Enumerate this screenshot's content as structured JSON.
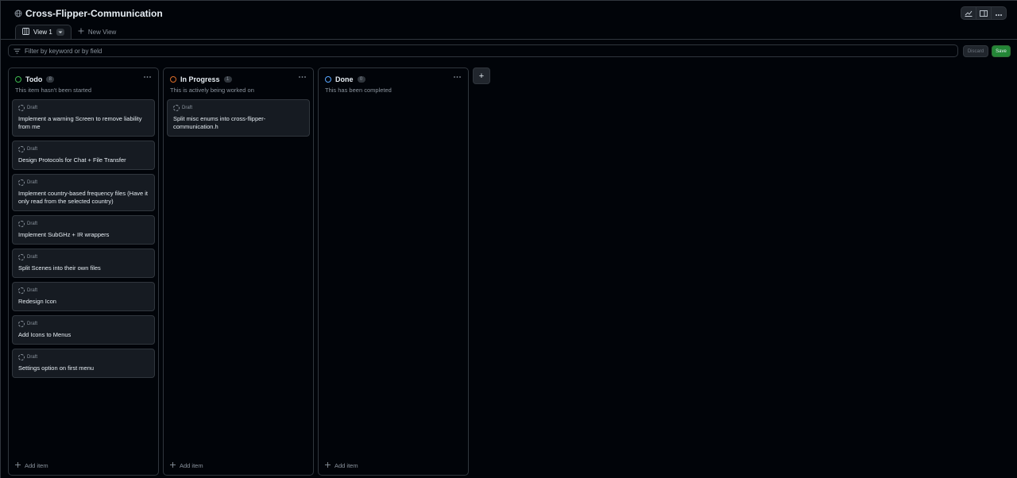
{
  "header": {
    "title": "Cross-Flipper-Communication",
    "icons": [
      "globe-icon",
      "graph-icon",
      "sidebar-icon",
      "kebab-icon"
    ]
  },
  "tabs": {
    "active_label": "View 1",
    "new_view_label": "New View"
  },
  "filter": {
    "placeholder": "Filter by keyword or by field",
    "discard_label": "Discard",
    "save_label": "Save"
  },
  "columns": [
    {
      "title": "Todo",
      "count": "8",
      "color": "#3fb950",
      "description": "This item hasn't been started",
      "add_label": "Add item",
      "cards": [
        {
          "tag": "Draft",
          "title": "Implement a warning Screen to remove liability from me"
        },
        {
          "tag": "Draft",
          "title": "Design Protocols for Chat + File Transfer"
        },
        {
          "tag": "Draft",
          "title": "Implement country-based frequency files (Have it only read from the selected country)"
        },
        {
          "tag": "Draft",
          "title": "Implement SubGHz + IR wrappers"
        },
        {
          "tag": "Draft",
          "title": "Split Scenes into their own files"
        },
        {
          "tag": "Draft",
          "title": "Redesign Icon"
        },
        {
          "tag": "Draft",
          "title": "Add Icons to Menus"
        },
        {
          "tag": "Draft",
          "title": "Settings option on first menu"
        }
      ]
    },
    {
      "title": "In Progress",
      "count": "1",
      "color": "#db6d28",
      "description": "This is actively being worked on",
      "add_label": "Add item",
      "cards": [
        {
          "tag": "Draft",
          "title": "Split misc enums into cross-flipper-communication.h"
        }
      ]
    },
    {
      "title": "Done",
      "count": "0",
      "color": "#58a6ff",
      "description": "This has been completed",
      "add_label": "Add item",
      "cards": []
    }
  ],
  "add_column_label": "+"
}
